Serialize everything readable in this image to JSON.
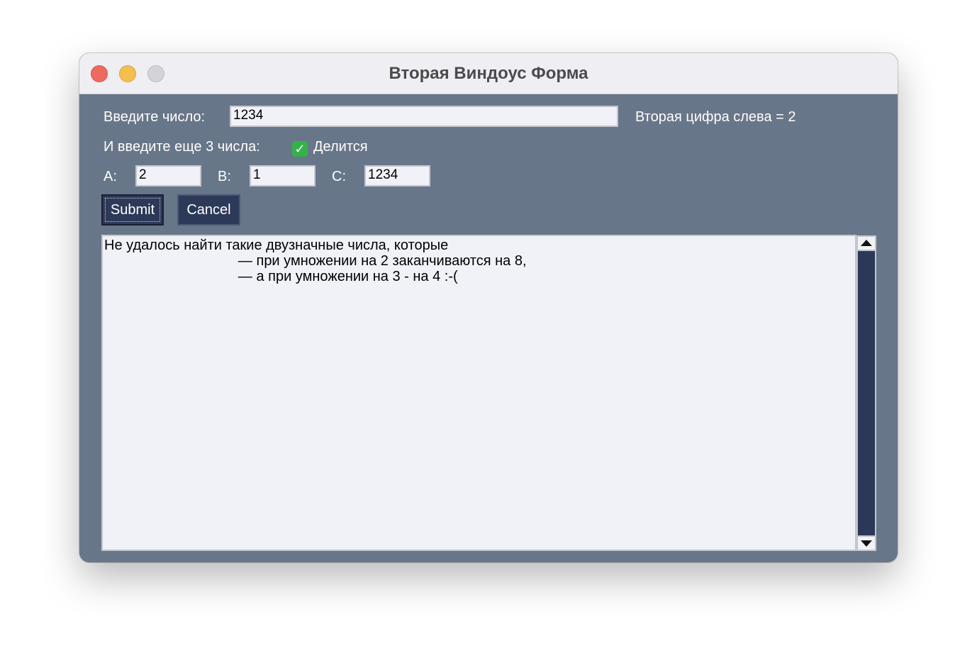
{
  "window": {
    "title": "Вторая Виндоус Форма"
  },
  "form": {
    "number_label": "Введите число:",
    "number_value": "1234",
    "second_digit_text": "Вторая цифра слева = 2",
    "three_numbers_label": "И введите еще 3 числа:",
    "status_icon": "check-icon",
    "status_text": "Делится",
    "a_label": "A:",
    "a_value": "2",
    "b_label": "B:",
    "b_value": "1",
    "c_label": "C:",
    "c_value": "1234"
  },
  "buttons": {
    "submit_label": "Submit",
    "cancel_label": "Cancel"
  },
  "output": {
    "lines": [
      "Не удалось найти такие двузначные числа, которые",
      "                                  — при умножении на 2 заканчиваются на 8,",
      "                                  — а при умножении на 3 - на 4 :-("
    ]
  },
  "colors": {
    "window_bg": "#687689",
    "button_bg": "#2d3959",
    "field_bg": "#f1f2f7",
    "close": "#ec6a5e",
    "minimize": "#f4bf4f",
    "zoom_disabled": "#d4d3d7",
    "check": "#36b14a"
  }
}
